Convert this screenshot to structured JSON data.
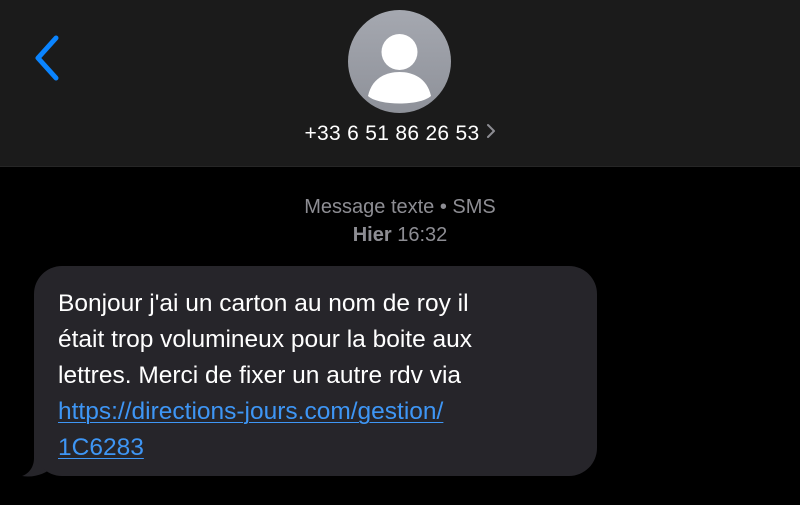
{
  "header": {
    "back_icon": "chevron-left-icon",
    "avatar_icon": "person-placeholder-icon",
    "contact_number": "+33 6 51 86 26 53",
    "contact_chevron_icon": "chevron-right-icon",
    "accent_color": "#0a84ff"
  },
  "conversation": {
    "message_type": "Message texte • SMS",
    "timestamp_day": "Hier",
    "timestamp_time": "16:32",
    "messages": [
      {
        "direction": "incoming",
        "text": "Bonjour j'ai un carton au nom de roy il\nétait trop volumineux pour la boite aux\nlettres. Merci de fixer un autre rdv via",
        "link": "https://directions-jours.com/gestion/\n1C6283",
        "bubble_color": "#26252a",
        "link_color": "#3e96f5"
      }
    ]
  }
}
